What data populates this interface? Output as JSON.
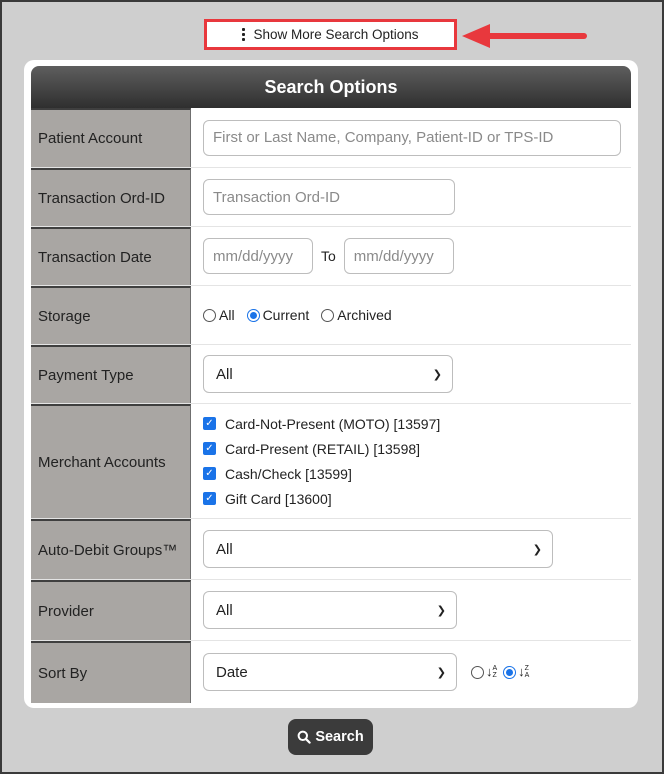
{
  "show_more": {
    "label": "Show More Search Options"
  },
  "panel": {
    "title": "Search Options"
  },
  "fields": {
    "patient_account": {
      "label": "Patient Account",
      "placeholder": "First or Last Name, Company, Patient-ID or TPS-ID"
    },
    "transaction_ord_id": {
      "label": "Transaction Ord-ID",
      "placeholder": "Transaction Ord-ID"
    },
    "transaction_date": {
      "label": "Transaction Date",
      "from_placeholder": "mm/dd/yyyy",
      "to_label": "To",
      "to_placeholder": "mm/dd/yyyy"
    },
    "storage": {
      "label": "Storage",
      "options": [
        {
          "label": "All",
          "selected": false
        },
        {
          "label": "Current",
          "selected": true
        },
        {
          "label": "Archived",
          "selected": false
        }
      ]
    },
    "payment_type": {
      "label": "Payment Type",
      "value": "All"
    },
    "merchant_accounts": {
      "label": "Merchant Accounts",
      "items": [
        {
          "label": "Card-Not-Present (MOTO) [13597]",
          "checked": true
        },
        {
          "label": "Card-Present (RETAIL) [13598]",
          "checked": true
        },
        {
          "label": "Cash/Check [13599]",
          "checked": true
        },
        {
          "label": "Gift Card [13600]",
          "checked": true
        }
      ]
    },
    "auto_debit_groups": {
      "label": "Auto-Debit Groups™",
      "value": "All"
    },
    "provider": {
      "label": "Provider",
      "value": "All"
    },
    "sort_by": {
      "label": "Sort By",
      "value": "Date",
      "ascending_selected": false,
      "descending_selected": true
    }
  },
  "search_button": {
    "label": "Search"
  },
  "colors": {
    "highlight": "#e8383d",
    "header_dark": "#2f2f2f",
    "label_bg": "#a9a6a3",
    "accent": "#1a73e8"
  }
}
